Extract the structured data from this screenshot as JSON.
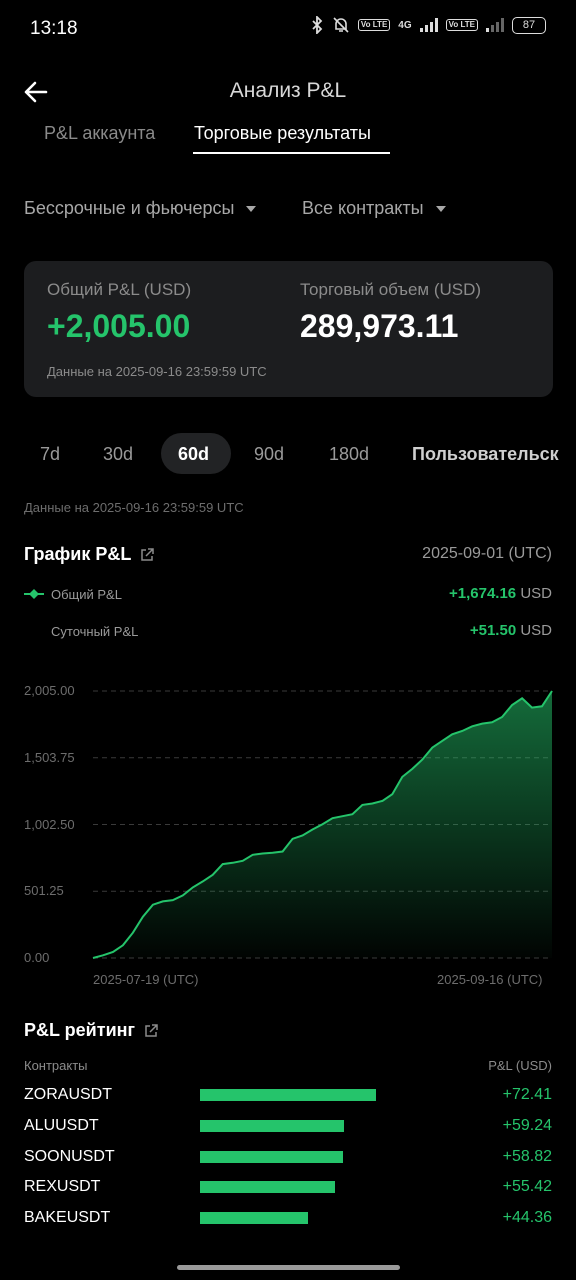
{
  "status_bar": {
    "time": "13:18",
    "volte1": "Vo LTE",
    "net": "4G",
    "volte2": "Vo LTE",
    "battery": "87"
  },
  "header": {
    "title": "Анализ P&L",
    "tabs": [
      {
        "label": "P&L аккаунта",
        "active": false
      },
      {
        "label": "Торговые результаты",
        "active": true
      }
    ]
  },
  "filters": {
    "market": "Бессрочные и фьючерсы",
    "contracts": "Все контракты"
  },
  "summary": {
    "pnl_label": "Общий P&L (USD)",
    "pnl_value": "+2,005.00",
    "volume_label": "Торговый объем (USD)",
    "volume_value": "289,973.11",
    "data_note": "Данные на 2025-09-16 23:59:59 UTC"
  },
  "periods": [
    {
      "label": "7d",
      "active": false
    },
    {
      "label": "30d",
      "active": false
    },
    {
      "label": "60d",
      "active": true
    },
    {
      "label": "90d",
      "active": false
    },
    {
      "label": "180d",
      "active": false
    },
    {
      "label": "Пользовательск",
      "active": false
    }
  ],
  "data_note2": "Данные на 2025-09-16 23:59:59 UTC",
  "chart": {
    "title": "График P&L",
    "selected_date": "2025-09-01 (UTC)",
    "legend": [
      {
        "label": "Общий P&L",
        "value": "+1,674.16",
        "unit": "USD"
      },
      {
        "label": "Суточный P&L",
        "value": "+51.50",
        "unit": "USD"
      }
    ],
    "accent": "#25c46b"
  },
  "chart_data": {
    "type": "area",
    "title": "График P&L",
    "yticks": [
      "2,005.00",
      "1,503.75",
      "1,002.50",
      "501.25",
      "0.00"
    ],
    "ylim": [
      0,
      2005
    ],
    "xticks": [
      "2025-07-19 (UTC)",
      "2025-09-16 (UTC)"
    ],
    "grid": true,
    "series": [
      {
        "name": "Общий P&L",
        "values": [
          0,
          20,
          45,
          95,
          190,
          310,
          400,
          425,
          435,
          470,
          530,
          575,
          625,
          705,
          715,
          730,
          775,
          785,
          790,
          800,
          895,
          920,
          965,
          1005,
          1050,
          1065,
          1080,
          1150,
          1160,
          1180,
          1230,
          1360,
          1420,
          1490,
          1580,
          1630,
          1680,
          1705,
          1740,
          1760,
          1770,
          1810,
          1900,
          1950,
          1880,
          1890,
          2005
        ]
      }
    ]
  },
  "ranking": {
    "title": "P&L рейтинг",
    "col_contract": "Контракты",
    "col_pnl": "P&L (USD)",
    "max": 72.41,
    "rows": [
      {
        "name": "ZORAUSDT",
        "value": 72.41,
        "label": "+72.41"
      },
      {
        "name": "ALUUSDT",
        "value": 59.24,
        "label": "+59.24"
      },
      {
        "name": "SOONUSDT",
        "value": 58.82,
        "label": "+58.82"
      },
      {
        "name": "REXUSDT",
        "value": 55.42,
        "label": "+55.42"
      },
      {
        "name": "BAKEUSDT",
        "value": 44.36,
        "label": "+44.36"
      }
    ]
  }
}
